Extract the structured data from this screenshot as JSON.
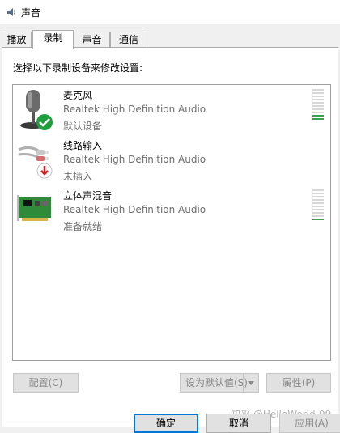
{
  "window": {
    "title": "声音"
  },
  "tabs": [
    {
      "label": "播放"
    },
    {
      "label": "录制"
    },
    {
      "label": "声音"
    },
    {
      "label": "通信"
    }
  ],
  "prompt": "选择以下录制设备来修改设置:",
  "devices": [
    {
      "name": "麦克风",
      "driver": "Realtek High Definition Audio",
      "status": "默认设备",
      "icon": "microphone-icon",
      "badge": "green-check-badge",
      "level": 0.2
    },
    {
      "name": "线路输入",
      "driver": "Realtek High Definition Audio",
      "status": "未插入",
      "icon": "line-in-cable-icon",
      "badge": "red-down-arrow-badge"
    },
    {
      "name": "立体声混音",
      "driver": "Realtek High Definition Audio",
      "status": "准备就绪",
      "icon": "sound-card-icon",
      "level": 0.1
    }
  ],
  "buttons": {
    "configure": "配置(C)",
    "set_default": "设为默认值(S)",
    "properties": "属性(P)",
    "ok": "确定",
    "cancel": "取消",
    "apply": "应用(A)"
  },
  "watermark": "知乎 @HelloWorld-99",
  "colors": {
    "accent": "#0078d7",
    "level_green": "#3aa34a",
    "check_green": "#1e9e3c",
    "badge_red": "#d42020"
  }
}
